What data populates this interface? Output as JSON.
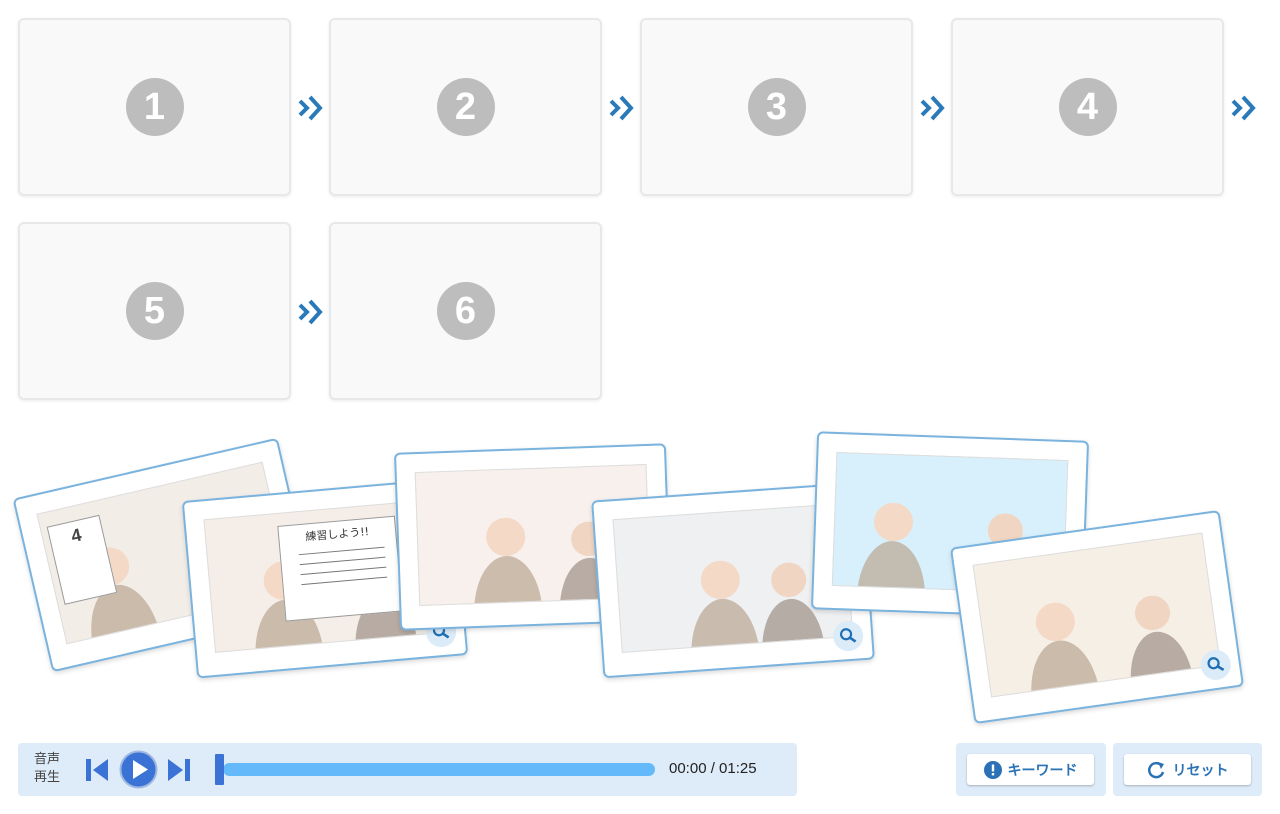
{
  "slots": [
    {
      "number": "1"
    },
    {
      "number": "2"
    },
    {
      "number": "3"
    },
    {
      "number": "4"
    },
    {
      "number": "5"
    },
    {
      "number": "6"
    }
  ],
  "cards": [
    {
      "scene": "teacher-with-calendar",
      "calendar_text": "4"
    },
    {
      "scene": "student-with-poster",
      "poster_text": "練習しよう!!"
    },
    {
      "scene": "teacher-at-door"
    },
    {
      "scene": "students-at-door"
    },
    {
      "scene": "two-students-talking"
    },
    {
      "scene": "trumpet-memory"
    }
  ],
  "player": {
    "label_line1": "音声",
    "label_line2": "再生",
    "time": "00:00 / 01:25",
    "progress": 0
  },
  "buttons": {
    "keyword": "キーワード",
    "reset": "リセット"
  },
  "colors": {
    "accent": "#2a7ab9",
    "card_border": "#7ab3de",
    "progress": "#64b9fb",
    "panel": "#deebf9"
  }
}
